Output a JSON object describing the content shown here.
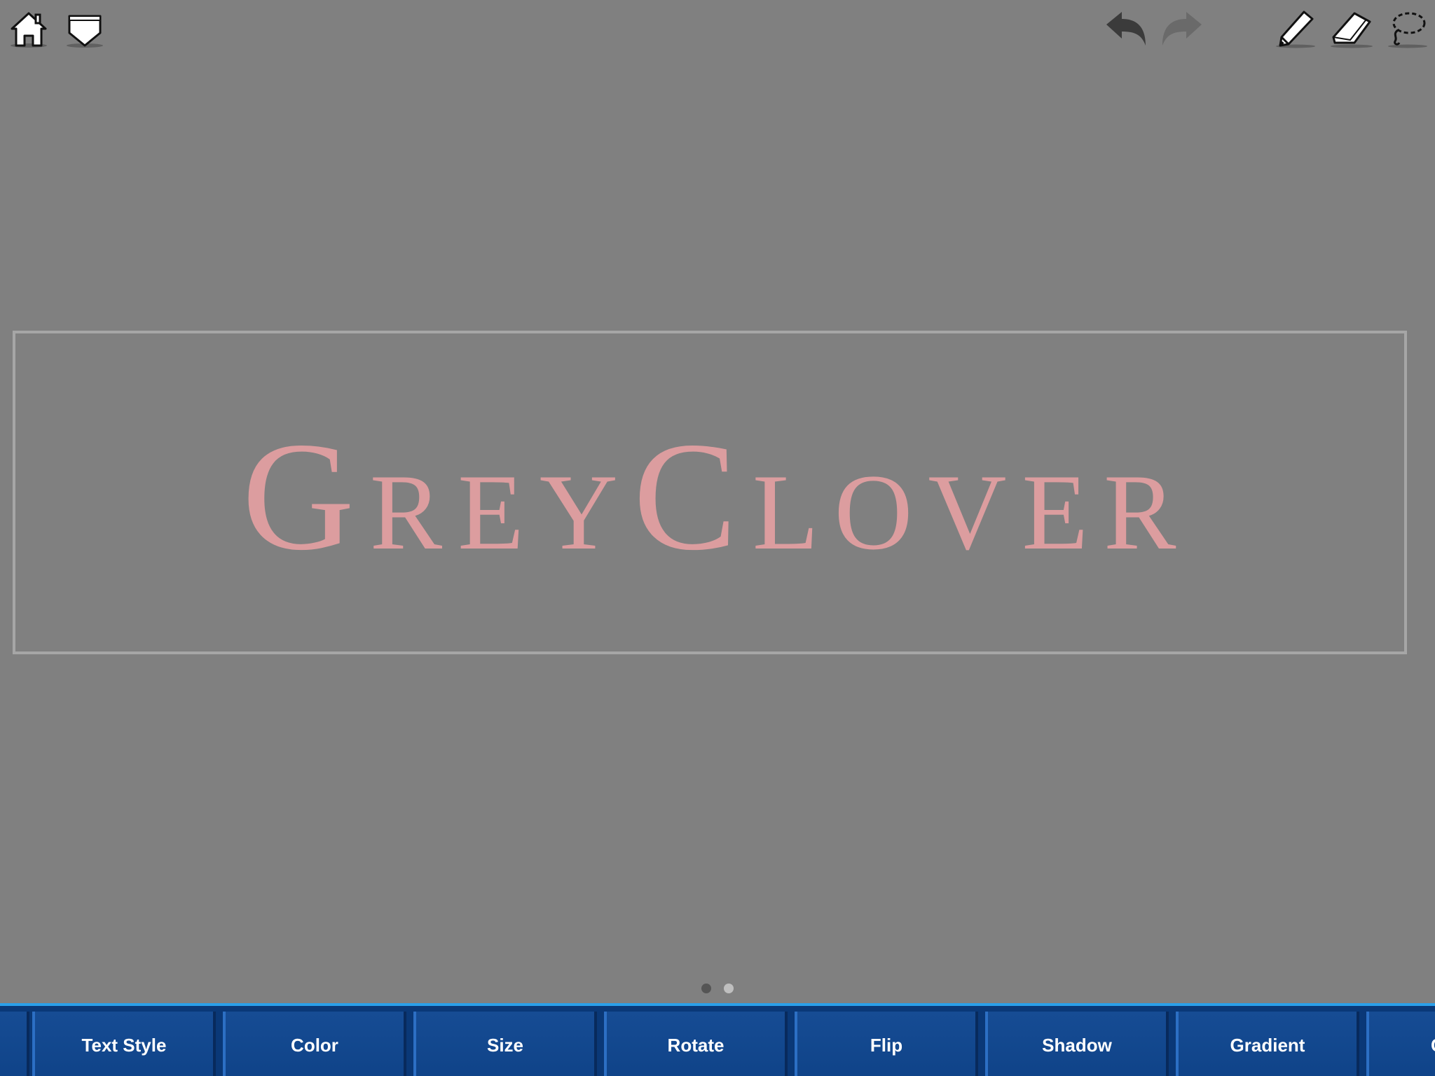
{
  "toolbar": {
    "left": [
      {
        "icon": "home-icon"
      },
      {
        "icon": "download-arrow-icon"
      }
    ],
    "right": [
      {
        "icon": "undo-icon"
      },
      {
        "icon": "redo-icon"
      },
      {
        "icon": "pencil-icon"
      },
      {
        "icon": "eraser-icon"
      },
      {
        "icon": "lasso-icon"
      }
    ]
  },
  "canvas": {
    "text": "GreyClover",
    "text_color": "#dc9d9f",
    "background": "#808080",
    "frame_color": "#a6a6a6"
  },
  "pager": {
    "pages": 2,
    "current": 1
  },
  "bottom_bar": {
    "tabs": [
      {
        "label": ""
      },
      {
        "label": "Text Style"
      },
      {
        "label": "Color"
      },
      {
        "label": "Size"
      },
      {
        "label": "Rotate"
      },
      {
        "label": "Flip"
      },
      {
        "label": "Shadow"
      },
      {
        "label": "Gradient"
      },
      {
        "label": "C"
      }
    ],
    "accent": "#2aa0ea",
    "tab_color": "#164c94"
  }
}
